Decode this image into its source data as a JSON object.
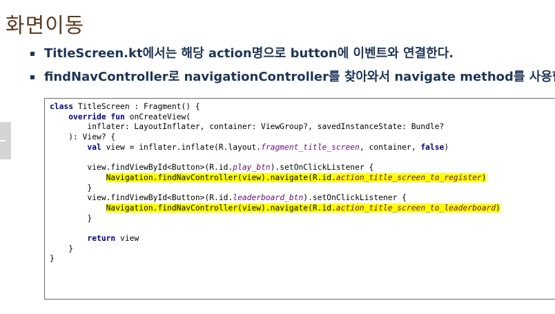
{
  "title": "화면이동",
  "bullets": [
    "TitleScreen.kt에서는 해당 action명으로 button에 이벤트와 연결한다.",
    "findNavController로 navigationController를 찾아와서 navigate method를 사용한다."
  ],
  "code": {
    "lines": [
      [
        {
          "t": "class",
          "c": "kw"
        },
        {
          "t": " TitleScreen : Fragment() {"
        }
      ],
      [
        {
          "t": "    "
        },
        {
          "t": "override fun",
          "c": "kw"
        },
        {
          "t": " onCreateView("
        }
      ],
      [
        {
          "t": "        inflater: LayoutInflater, container: ViewGroup?, savedInstanceState: Bundle?"
        }
      ],
      [
        {
          "t": "    ): View? {"
        }
      ],
      [
        {
          "t": "        "
        },
        {
          "t": "val",
          "c": "kw"
        },
        {
          "t": " view = inflater.inflate(R.layout."
        },
        {
          "t": "fragment_title_screen",
          "c": "it"
        },
        {
          "t": ", container, "
        },
        {
          "t": "false",
          "c": "kw"
        },
        {
          "t": ")"
        }
      ],
      [
        {
          "t": ""
        }
      ],
      [
        {
          "t": "        view.findViewById<Button>(R.id."
        },
        {
          "t": "play_btn",
          "c": "it"
        },
        {
          "t": ").setOnClickListener {"
        }
      ],
      [
        {
          "t": "            "
        },
        {
          "t": "Navigation.findNavController(view).navigate(R.id.",
          "c": "hl"
        },
        {
          "t": "action_title_screen_to_register",
          "c": "hl it"
        },
        {
          "t": ")",
          "c": "hl"
        }
      ],
      [
        {
          "t": "        }"
        }
      ],
      [
        {
          "t": "        view.findViewById<Button>(R.id."
        },
        {
          "t": "leaderboard_btn",
          "c": "it"
        },
        {
          "t": ").setOnClickListener {"
        }
      ],
      [
        {
          "t": "            "
        },
        {
          "t": "Navigation.findNavController(view).navigate(R.id.",
          "c": "hl"
        },
        {
          "t": "action_title_screen_to_leaderboard",
          "c": "hl it"
        },
        {
          "t": ")",
          "c": "hl"
        }
      ],
      [
        {
          "t": "        }"
        }
      ],
      [
        {
          "t": ""
        }
      ],
      [
        {
          "t": "        "
        },
        {
          "t": "return",
          "c": "kw"
        },
        {
          "t": " view"
        }
      ],
      [
        {
          "t": "    }"
        }
      ],
      [
        {
          "t": "}"
        }
      ]
    ]
  }
}
